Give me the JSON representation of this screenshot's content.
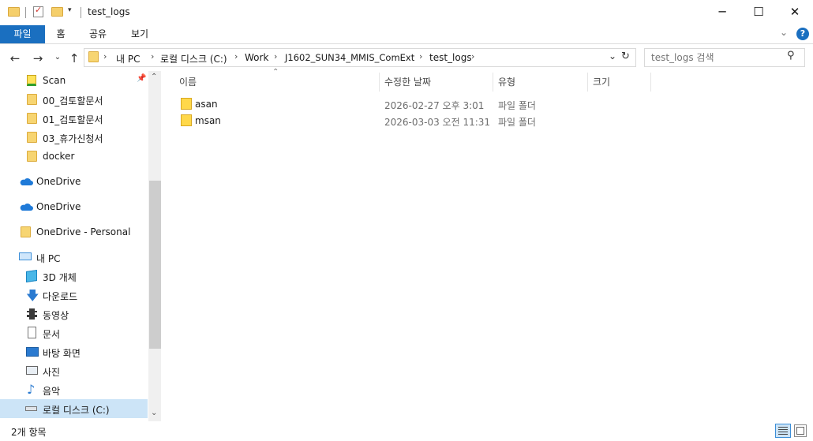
{
  "window": {
    "title": "test_logs",
    "minimize_icon": "─",
    "maximize_icon": "☐",
    "close_icon": "✕"
  },
  "ribbon": {
    "tabs": [
      "파일",
      "홈",
      "공유",
      "보기"
    ]
  },
  "address": {
    "crumbs": [
      "내 PC",
      "로컬 디스크 (C:)",
      "Work",
      "J1602_SUN34_MMIS_ComExt",
      "test_logs"
    ]
  },
  "search": {
    "placeholder": "test_logs 검색"
  },
  "nav": {
    "items": [
      {
        "label": "Scan",
        "icon": "scan-icon"
      },
      {
        "label": "00_검토할문서",
        "icon": "folder-icon"
      },
      {
        "label": "01_검토할문서",
        "icon": "folder-icon"
      },
      {
        "label": "03_휴가신청서",
        "icon": "folder-icon"
      },
      {
        "label": "docker",
        "icon": "folder-icon"
      },
      {
        "label": "OneDrive",
        "icon": "onedrive-icon"
      },
      {
        "label": "OneDrive",
        "icon": "onedrive-icon"
      },
      {
        "label": "OneDrive - Personal",
        "icon": "folder-icon"
      },
      {
        "label": "내 PC",
        "icon": "pc-icon"
      },
      {
        "label": "3D 개체",
        "icon": "3d-objects-icon"
      },
      {
        "label": "다운로드",
        "icon": "downloads-icon"
      },
      {
        "label": "동영상",
        "icon": "videos-icon"
      },
      {
        "label": "문서",
        "icon": "documents-icon"
      },
      {
        "label": "바탕 화면",
        "icon": "desktop-icon"
      },
      {
        "label": "사진",
        "icon": "pictures-icon"
      },
      {
        "label": "음악",
        "icon": "music-icon"
      },
      {
        "label": "로컬 디스크 (C:)",
        "icon": "drive-icon"
      }
    ]
  },
  "columns": [
    "이름",
    "수정한 날짜",
    "유형",
    "크기"
  ],
  "files": [
    {
      "name": "asan",
      "modified": "2026-02-27 오후 3:01",
      "type": "파일 폴더",
      "size": ""
    },
    {
      "name": "msan",
      "modified": "2026-03-03 오전 11:31",
      "type": "파일 폴더",
      "size": ""
    }
  ],
  "status": {
    "count": "2개 항목"
  }
}
